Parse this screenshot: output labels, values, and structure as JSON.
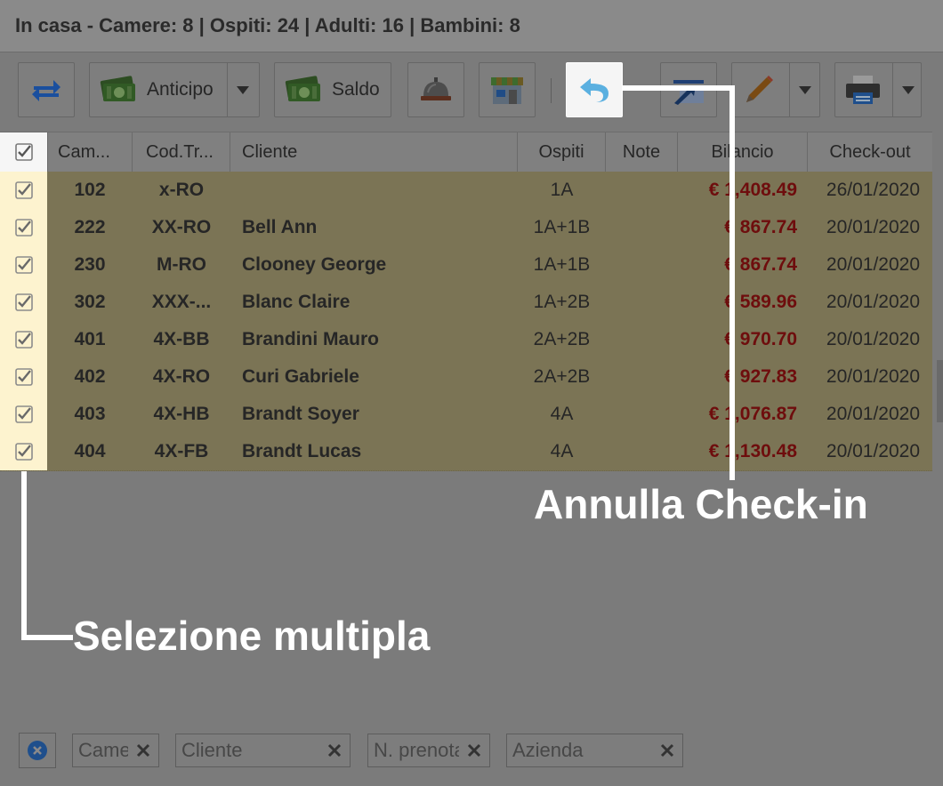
{
  "header": {
    "title": "In casa - Camere: 8 | Ospiti: 24 | Adulti: 16 | Bambini: 8"
  },
  "toolbar": {
    "refresh_icon": "swap-arrows-icon",
    "anticipo_label": "Anticipo",
    "saldo_label": "Saldo",
    "money_icon": "banknotes-icon",
    "bell_icon": "reception-bell-icon",
    "shop_icon": "store-icon",
    "undo_icon": "undo-arrow-icon",
    "doc_icon": "document-arrow-icon",
    "edit_icon": "pencil-icon",
    "print_icon": "printer-icon"
  },
  "grid": {
    "columns": [
      "Cam...",
      "Cod.Tr...",
      "Cliente",
      "Ospiti",
      "Note",
      "Bilancio",
      "Check-out"
    ],
    "rows": [
      {
        "camera": "102",
        "cod": "x-RO",
        "cliente": "",
        "ospiti": "1A",
        "note": "",
        "bilancio": "€ 1,408.49",
        "checkout": "26/01/2020"
      },
      {
        "camera": "222",
        "cod": "XX-RO",
        "cliente": "Bell Ann",
        "ospiti": "1A+1B",
        "note": "",
        "bilancio": "€ 867.74",
        "checkout": "20/01/2020"
      },
      {
        "camera": "230",
        "cod": "M-RO",
        "cliente": "Clooney George",
        "ospiti": "1A+1B",
        "note": "",
        "bilancio": "€ 867.74",
        "checkout": "20/01/2020"
      },
      {
        "camera": "302",
        "cod": "XXX-...",
        "cliente": "Blanc Claire",
        "ospiti": "1A+2B",
        "note": "",
        "bilancio": "€ 589.96",
        "checkout": "20/01/2020"
      },
      {
        "camera": "401",
        "cod": "4X-BB",
        "cliente": "Brandini Mauro",
        "ospiti": "2A+2B",
        "note": "",
        "bilancio": "€ 970.70",
        "checkout": "20/01/2020"
      },
      {
        "camera": "402",
        "cod": "4X-RO",
        "cliente": "Curi Gabriele",
        "ospiti": "2A+2B",
        "note": "",
        "bilancio": "€ 927.83",
        "checkout": "20/01/2020"
      },
      {
        "camera": "403",
        "cod": "4X-HB",
        "cliente": "Brandt Soyer",
        "ospiti": "4A",
        "note": "",
        "bilancio": "€ 1,076.87",
        "checkout": "20/01/2020"
      },
      {
        "camera": "404",
        "cod": "4X-FB",
        "cliente": "Brandt Lucas",
        "ospiti": "4A",
        "note": "",
        "bilancio": "€ 1,130.48",
        "checkout": "20/01/2020"
      }
    ]
  },
  "callouts": {
    "annulla": "Annulla Check-in",
    "selezione": "Selezione multipla"
  },
  "filters": {
    "clear_icon": "clear-circle-icon",
    "camera_placeholder": "Camera",
    "cliente_placeholder": "Cliente",
    "prenotazione_placeholder": "N. prenotazione",
    "azienda_placeholder": "Azienda"
  },
  "colors": {
    "accent_blue": "#1f6fd6",
    "money_red": "#6e0d0d",
    "row_bg": "#7b7455",
    "selection_highlight": "#fdf3cf"
  }
}
